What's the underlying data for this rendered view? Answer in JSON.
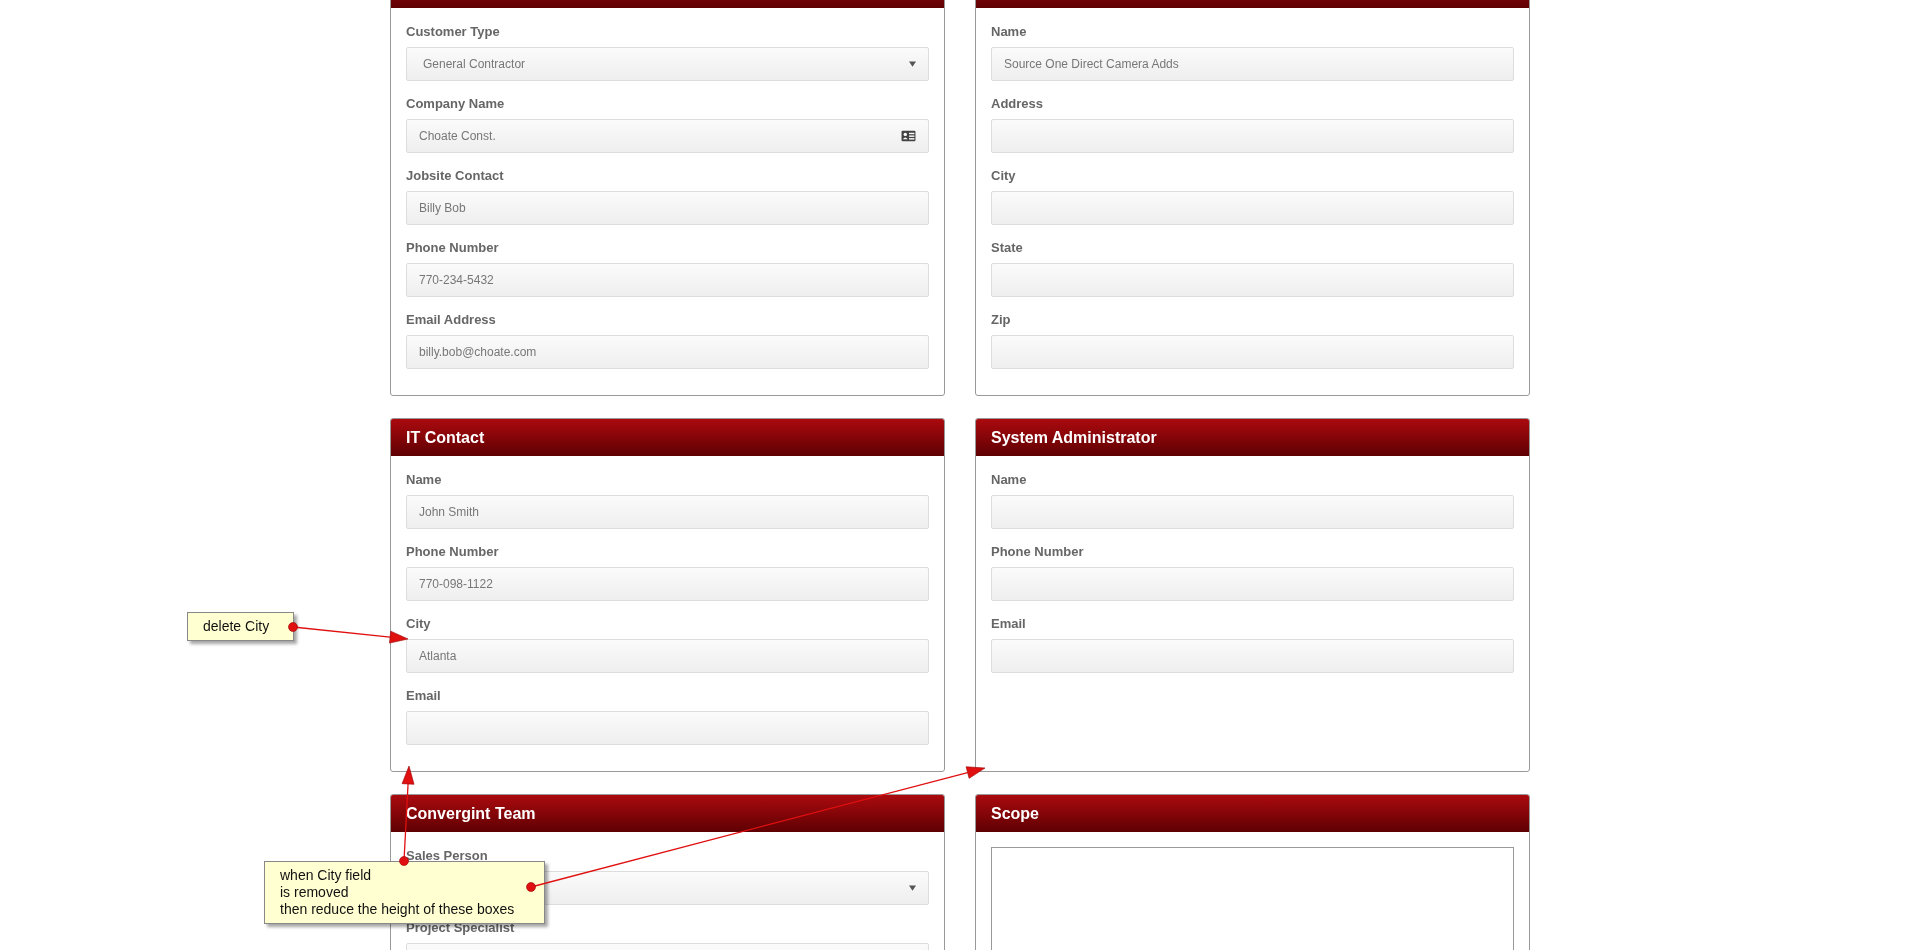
{
  "panels": [
    {
      "fields": [
        {
          "label": "Customer Type",
          "kind": "select",
          "value": "General Contractor"
        },
        {
          "label": "Company Name",
          "kind": "card",
          "value": "Choate Const."
        },
        {
          "label": "Jobsite Contact",
          "kind": "text",
          "value": "Billy Bob"
        },
        {
          "label": "Phone Number",
          "kind": "text",
          "value": "770-234-5432"
        },
        {
          "label": "Email Address",
          "kind": "text",
          "value": "billy.bob@choate.com"
        }
      ]
    },
    {
      "fields": [
        {
          "label": "Name",
          "kind": "text",
          "value": "Source One Direct Camera Adds"
        },
        {
          "label": "Address",
          "kind": "text"
        },
        {
          "label": "City",
          "kind": "text"
        },
        {
          "label": "State",
          "kind": "text"
        },
        {
          "label": "Zip",
          "kind": "text"
        }
      ]
    },
    {
      "title": "IT Contact",
      "fields": [
        {
          "label": "Name",
          "kind": "text",
          "value": "John Smith"
        },
        {
          "label": "Phone Number",
          "kind": "text",
          "value": "770-098-1122"
        },
        {
          "label": "City",
          "kind": "text",
          "value": "Atlanta"
        },
        {
          "label": "Email",
          "kind": "text"
        }
      ]
    },
    {
      "title": "System Administrator",
      "fields": [
        {
          "label": "Name",
          "kind": "text"
        },
        {
          "label": "Phone Number",
          "kind": "text"
        },
        {
          "label": "Email",
          "kind": "text"
        }
      ]
    },
    {
      "title": "Convergint Team",
      "fields": [
        {
          "label": "Sales Person",
          "kind": "select"
        },
        {
          "label": "Project Specialist",
          "kind": "text"
        }
      ]
    },
    {
      "title": "Scope",
      "fields": [
        {
          "kind": "textarea"
        }
      ]
    }
  ],
  "annotations": [
    {
      "text": "delete City"
    },
    {
      "text": "when City field\nis removed\nthen reduce the height of these boxes"
    }
  ]
}
